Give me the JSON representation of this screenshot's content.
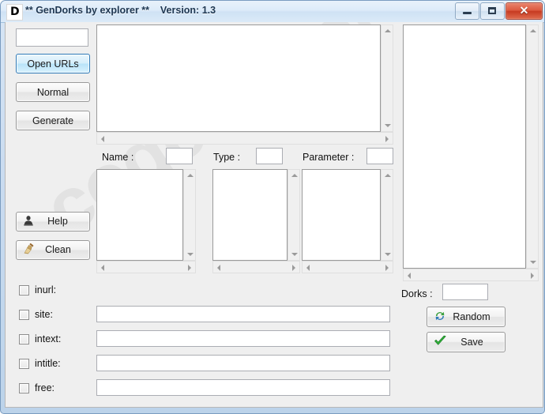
{
  "window": {
    "icon": "app-d-icon",
    "title": "** GenDorks by explorer **    Version: 1.3",
    "minimize_label": "",
    "maximize_label": "",
    "close_label": "✕",
    "watermark": "codeby.net",
    "accent_color": "#2f7bb8",
    "titlebar_color": "#dcebf9",
    "close_button_color": "#c63a21"
  },
  "sidebar": {
    "url_input": {
      "value": "",
      "placeholder": ""
    },
    "buttons": [
      {
        "label": "Open URLs",
        "name": "open-urls-button",
        "accent": true
      },
      {
        "label": "Normal",
        "name": "normal-button",
        "accent": false
      },
      {
        "label": "Generate",
        "name": "generate-button",
        "accent": false
      }
    ],
    "tool_buttons": [
      {
        "label": "Help",
        "icon": "person-icon",
        "name": "help-button"
      },
      {
        "label": "Clean",
        "icon": "broom-icon",
        "name": "clean-button"
      }
    ]
  },
  "main": {
    "urls_textarea": {
      "value": "",
      "placeholder": ""
    },
    "fields": [
      {
        "label": "Name :",
        "value": "",
        "name": "name-field"
      },
      {
        "label": "Type :",
        "value": "",
        "name": "type-field"
      },
      {
        "label": "Parameter :",
        "value": "",
        "name": "parameter-field"
      }
    ],
    "lists": [
      {
        "name": "name-list",
        "items": []
      },
      {
        "name": "type-list",
        "items": []
      },
      {
        "name": "parameter-list",
        "items": []
      }
    ],
    "results_list": {
      "name": "results-list",
      "items": []
    }
  },
  "filters": [
    {
      "label": "inurl:",
      "checked": false,
      "has_input": false,
      "value": ""
    },
    {
      "label": "site:",
      "checked": false,
      "has_input": true,
      "value": ""
    },
    {
      "label": "intext:",
      "checked": false,
      "has_input": true,
      "value": ""
    },
    {
      "label": "intitle:",
      "checked": false,
      "has_input": true,
      "value": ""
    },
    {
      "label": "free:",
      "checked": false,
      "has_input": true,
      "value": ""
    }
  ],
  "actions": {
    "dorks_label": "Dorks :",
    "dorks_value": "",
    "random_label": "Random",
    "random_icon": "refresh-icon",
    "save_label": "Save",
    "save_icon": "checkmark-icon"
  }
}
